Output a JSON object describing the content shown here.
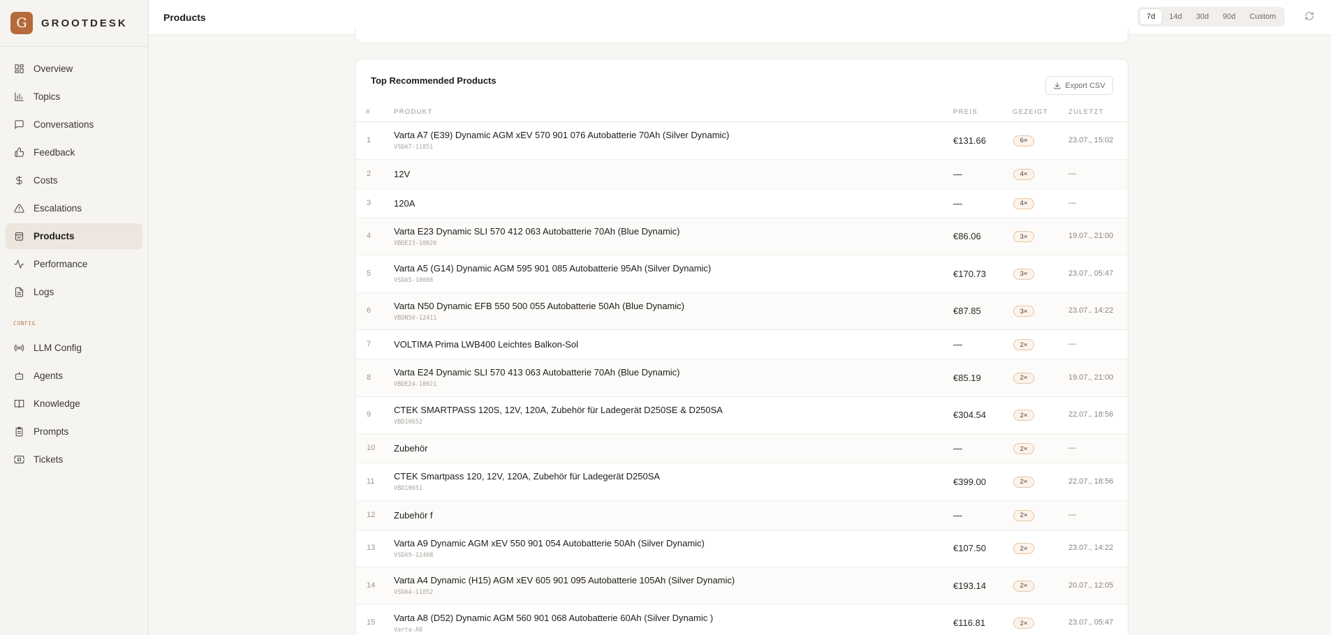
{
  "brand": {
    "logo_letter": "G",
    "name": "GROOTDESK",
    "accent": "#b46a3a"
  },
  "nav": [
    {
      "label": "Overview",
      "icon": "grid-icon"
    },
    {
      "label": "Topics",
      "icon": "bar-chart-icon"
    },
    {
      "label": "Conversations",
      "icon": "message-icon"
    },
    {
      "label": "Feedback",
      "icon": "thumbs-up-icon"
    },
    {
      "label": "Costs",
      "icon": "dollar-icon"
    },
    {
      "label": "Escalations",
      "icon": "warning-icon"
    },
    {
      "label": "Products",
      "icon": "bag-icon",
      "active": true
    },
    {
      "label": "Performance",
      "icon": "activity-icon"
    },
    {
      "label": "Logs",
      "icon": "file-icon"
    }
  ],
  "config_label": "CONFIG",
  "config_nav": [
    {
      "label": "LLM Config",
      "icon": "radio-icon"
    },
    {
      "label": "Agents",
      "icon": "bot-icon"
    },
    {
      "label": "Knowledge",
      "icon": "book-icon"
    },
    {
      "label": "Prompts",
      "icon": "clipboard-icon"
    },
    {
      "label": "Tickets",
      "icon": "ticket-icon"
    }
  ],
  "header": {
    "title": "Products",
    "ranges": [
      "7d",
      "14d",
      "30d",
      "90d",
      "Custom"
    ],
    "active_range": "7d"
  },
  "card": {
    "title": "Top Recommended Products",
    "export_label": "Export CSV",
    "columns": {
      "num": "#",
      "product": "PRODUKT",
      "price": "PREIS",
      "shown": "GEZEIGT",
      "last": "ZULETZT"
    }
  },
  "rows": [
    {
      "num": "1",
      "name": "Varta A7 (E39) Dynamic AGM xEV 570 901 076 Autobatterie 70Ah (Silver Dynamic)",
      "sku": "VSDA7-11851",
      "price": "€131.66",
      "shown": "6×",
      "last": "23.07., 15:02"
    },
    {
      "num": "2",
      "name": "12V",
      "sku": "",
      "price": "—",
      "shown": "4×",
      "last": "—"
    },
    {
      "num": "3",
      "name": "120A",
      "sku": "",
      "price": "—",
      "shown": "4×",
      "last": "—"
    },
    {
      "num": "4",
      "name": "Varta E23 Dynamic SLI 570 412 063 Autobatterie 70Ah (Blue Dynamic)",
      "sku": "VBDE23-10020",
      "price": "€86.06",
      "shown": "3×",
      "last": "19.07., 21:00"
    },
    {
      "num": "5",
      "name": "Varta A5 (G14) Dynamic AGM 595 901 085 Autobatterie 95Ah (Silver Dynamic)",
      "sku": "VSDA5-10008",
      "price": "€170.73",
      "shown": "3×",
      "last": "23.07., 05:47"
    },
    {
      "num": "6",
      "name": "Varta N50 Dynamic EFB 550 500 055 Autobatterie 50Ah (Blue Dynamic)",
      "sku": "VBDN50-12411",
      "price": "€87.85",
      "shown": "3×",
      "last": "23.07., 14:22"
    },
    {
      "num": "7",
      "name": "VOLTIMA Prima LWB400 Leichtes Balkon-Sol",
      "sku": "",
      "price": "—",
      "shown": "2×",
      "last": "—"
    },
    {
      "num": "8",
      "name": "Varta E24 Dynamic SLI 570 413 063 Autobatterie 70Ah (Blue Dynamic)",
      "sku": "VBDE24-10021",
      "price": "€85.19",
      "shown": "2×",
      "last": "19.07., 21:00"
    },
    {
      "num": "9",
      "name": "CTEK SMARTPASS 120S, 12V, 120A, Zubehör für Ladegerät D250SE & D250SA",
      "sku": "VBD10652",
      "price": "€304.54",
      "shown": "2×",
      "last": "22.07., 18:56"
    },
    {
      "num": "10",
      "name": "Zubehör",
      "sku": "",
      "price": "—",
      "shown": "2×",
      "last": "—"
    },
    {
      "num": "11",
      "name": "CTEK Smartpass 120, 12V, 120A, Zubehör für Ladegerät D250SA",
      "sku": "VBD10651",
      "price": "€399.00",
      "shown": "2×",
      "last": "22.07., 18:56"
    },
    {
      "num": "12",
      "name": "Zubehör f",
      "sku": "",
      "price": "—",
      "shown": "2×",
      "last": "—"
    },
    {
      "num": "13",
      "name": "Varta A9 Dynamic AGM xEV 550 901 054 Autobatterie 50Ah (Silver Dynamic)",
      "sku": "VSDA9-12408",
      "price": "€107.50",
      "shown": "2×",
      "last": "23.07., 14:22"
    },
    {
      "num": "14",
      "name": "Varta A4 Dynamic (H15) AGM xEV 605 901 095 Autobatterie 105Ah (Silver Dynamic)",
      "sku": "VSDA4-11852",
      "price": "€193.14",
      "shown": "2×",
      "last": "20.07., 12:05"
    },
    {
      "num": "15",
      "name": "Varta A8 (D52) Dynamic AGM 560 901 068 Autobatterie 60Ah (Silver Dynamic )",
      "sku": "Varta-A8",
      "price": "€116.81",
      "shown": "2×",
      "last": "23.07., 05:47"
    }
  ]
}
